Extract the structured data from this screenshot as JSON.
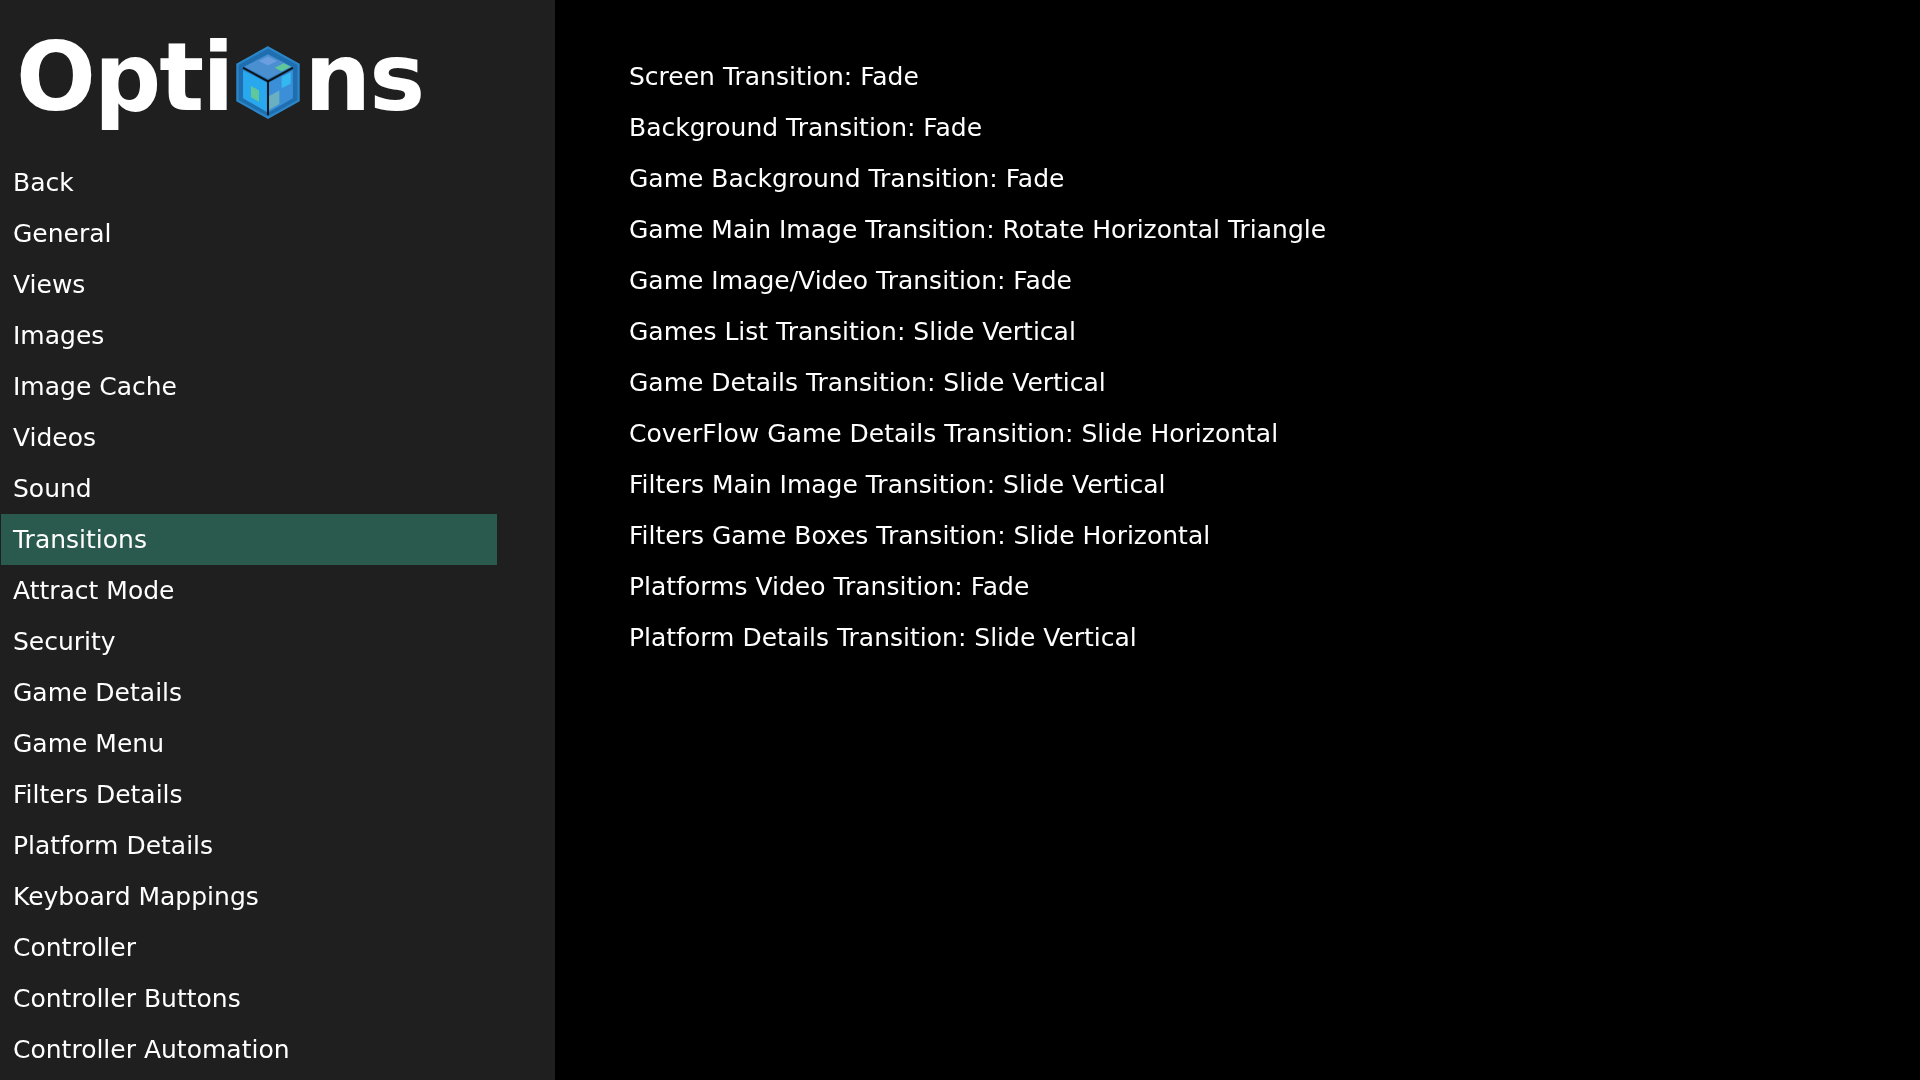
{
  "logo": {
    "before": "Opti",
    "after": "ns"
  },
  "sidebar": {
    "items": [
      {
        "label": "Back",
        "selected": false
      },
      {
        "label": "General",
        "selected": false
      },
      {
        "label": "Views",
        "selected": false
      },
      {
        "label": "Images",
        "selected": false
      },
      {
        "label": "Image Cache",
        "selected": false
      },
      {
        "label": "Videos",
        "selected": false
      },
      {
        "label": "Sound",
        "selected": false
      },
      {
        "label": "Transitions",
        "selected": true
      },
      {
        "label": "Attract Mode",
        "selected": false
      },
      {
        "label": "Security",
        "selected": false
      },
      {
        "label": "Game Details",
        "selected": false
      },
      {
        "label": "Game Menu",
        "selected": false
      },
      {
        "label": "Filters Details",
        "selected": false
      },
      {
        "label": "Platform Details",
        "selected": false
      },
      {
        "label": "Keyboard Mappings",
        "selected": false
      },
      {
        "label": "Controller",
        "selected": false
      },
      {
        "label": "Controller Buttons",
        "selected": false
      },
      {
        "label": "Controller Automation",
        "selected": false
      }
    ]
  },
  "settings": [
    "Screen Transition: Fade",
    "Background Transition: Fade",
    "Game Background Transition: Fade",
    "Game Main Image Transition: Rotate Horizontal Triangle",
    "Game Image/Video Transition: Fade",
    "Games List Transition: Slide Vertical",
    "Game Details Transition: Slide Vertical",
    "CoverFlow Game Details Transition: Slide Horizontal",
    "Filters Main Image Transition: Slide Vertical",
    "Filters Game Boxes Transition: Slide Horizontal",
    "Platforms Video Transition: Fade",
    "Platform Details Transition: Slide Vertical"
  ]
}
